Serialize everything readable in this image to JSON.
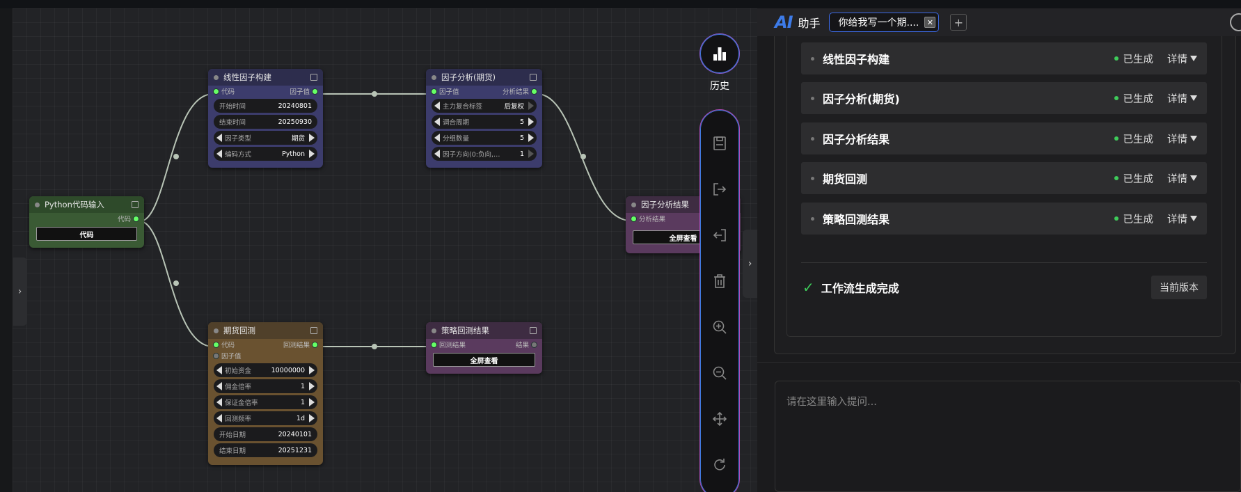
{
  "canvas": {
    "nodes": {
      "python_input": {
        "title": "Python代码输入",
        "out_port": "代码",
        "button": "代码"
      },
      "linear": {
        "title": "线性因子构建",
        "in_port": "代码",
        "out_port": "因子值",
        "w1_label": "开始时间",
        "w1_value": "20240801",
        "w2_label": "结束时间",
        "w2_value": "20250930",
        "w3_label": "因子类型",
        "w3_value": "期货",
        "w4_label": "编码方式",
        "w4_value": "Python"
      },
      "factor_analysis": {
        "title": "因子分析(期货)",
        "in_port": "因子值",
        "out_port": "分析结果",
        "w1_label": "主力复合标签",
        "w1_value": "后复权",
        "w2_label": "调合周期",
        "w2_value": "5",
        "w3_label": "分组数量",
        "w3_value": "5",
        "w4_label": "因子方向(0:负向,…",
        "w4_value": "1"
      },
      "factor_result": {
        "title": "因子分析结果",
        "in_port": "分析结果",
        "button": "全屏查看"
      },
      "backtest": {
        "title": "期货回测",
        "in_port1": "代码",
        "in_port2": "因子值",
        "out_port": "回测结果",
        "w1_label": "初始资金",
        "w1_value": "10000000",
        "w2_label": "佣金倍率",
        "w2_value": "1",
        "w3_label": "保证金倍率",
        "w3_value": "1",
        "w4_label": "回测频率",
        "w4_value": "1d",
        "w5_label": "开始日期",
        "w5_value": "20240101",
        "w6_label": "结束日期",
        "w6_value": "20251231"
      },
      "strategy_result": {
        "title": "策略回测结果",
        "in_port": "回测结果",
        "out_port": "结果",
        "button": "全屏查看"
      }
    }
  },
  "toolbar": {
    "history_label": "历史",
    "icons": [
      "save-icon",
      "export-icon",
      "import-icon",
      "trash-icon",
      "zoom-in-icon",
      "zoom-out-icon",
      "move-icon",
      "refresh-icon"
    ]
  },
  "panel": {
    "logo": "AI",
    "title": "助手",
    "chip_label": "你给我写一个期....",
    "chip_close": "✕",
    "add_label": "+",
    "steps": [
      {
        "name": "线性因子构建",
        "status": "已生成",
        "detail": "详情"
      },
      {
        "name": "因子分析(期货)",
        "status": "已生成",
        "detail": "详情"
      },
      {
        "name": "因子分析结果",
        "status": "已生成",
        "detail": "详情"
      },
      {
        "name": "期货回测",
        "status": "已生成",
        "detail": "详情"
      },
      {
        "name": "策略回测结果",
        "status": "已生成",
        "detail": "详情"
      }
    ],
    "done_mark": "✓",
    "done_text": "工作流生成完成",
    "version_button": "当前版本",
    "input_placeholder": "请在这里输入提问..."
  },
  "toggles": {
    "left": "›",
    "mid": "›"
  },
  "colors": {
    "accent": "#3d7be8",
    "success": "#3ecb5a",
    "tool_border": "#b04cb8"
  }
}
